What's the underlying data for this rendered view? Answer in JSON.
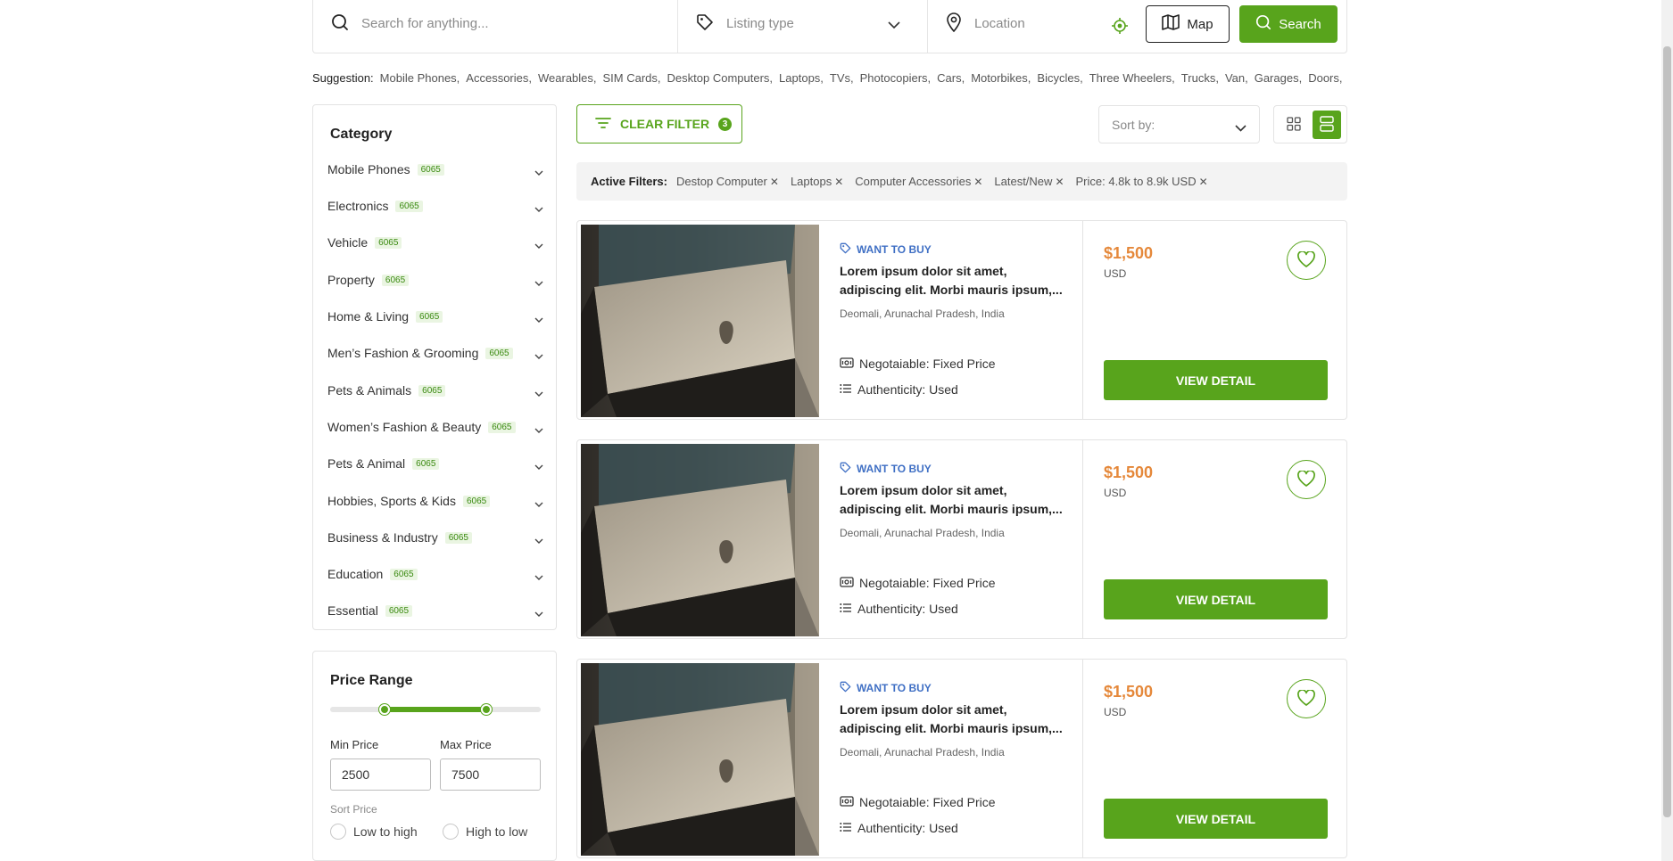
{
  "search": {
    "placeholder": "Search for anything...",
    "listing_type_placeholder": "Listing type",
    "location_placeholder": "Location",
    "map_label": "Map",
    "search_label": "Search"
  },
  "suggestions": {
    "label": "Suggestion:",
    "items": [
      "Mobile Phones,",
      "Accessories,",
      "Wearables,",
      "SIM Cards,",
      "Desktop Computers,",
      "Laptops,",
      "TVs,",
      "Photocopiers,",
      "Cars,",
      "Motorbikes,",
      "Bicycles,",
      "Three Wheelers,",
      "Trucks,",
      "Van,",
      "Garages,",
      "Doors,"
    ]
  },
  "sidebar": {
    "title": "Category",
    "categories": [
      {
        "name": "Mobile Phones",
        "count": "6065"
      },
      {
        "name": "Electronics",
        "count": "6065"
      },
      {
        "name": "Vehicle",
        "count": "6065"
      },
      {
        "name": "Property",
        "count": "6065"
      },
      {
        "name": "Home & Living",
        "count": "6065"
      },
      {
        "name": "Men’s Fashion & Grooming",
        "count": "6065"
      },
      {
        "name": "Pets & Animals",
        "count": "6065"
      },
      {
        "name": "Women’s Fashion & Beauty",
        "count": "6065"
      },
      {
        "name": "Pets & Animal",
        "count": "6065"
      },
      {
        "name": "Hobbies, Sports & Kids",
        "count": "6065"
      },
      {
        "name": "Business & Industry",
        "count": "6065"
      },
      {
        "name": "Education",
        "count": "6065"
      },
      {
        "name": "Essential",
        "count": "6065"
      }
    ]
  },
  "price_range": {
    "title": "Price Range",
    "slider_min_fraction": 0.26,
    "slider_max_fraction": 0.74,
    "min_label": "Min Price",
    "max_label": "Max Price",
    "min_value": "2500",
    "max_value": "7500",
    "sort_label": "Sort Price",
    "sort_options": [
      "Low to high",
      "High to low"
    ]
  },
  "toolbar": {
    "clear_filter_label": "CLEAR FILTER",
    "clear_filter_count": "3",
    "sort_placeholder": "Sort by:"
  },
  "active_filters": {
    "label": "Active Filters:",
    "items": [
      "Destop Computer",
      "Laptops",
      "Computer Accessories",
      "Latest/New",
      "Price: 4.8k to 8.9k USD"
    ],
    "remove_glyph": "✕"
  },
  "listings": [
    {
      "tag": "WANT TO BUY",
      "title": "Lorem ipsum dolor sit amet, adipiscing elit. Morbi mauris ipsum,...",
      "location": "Deomali, Arunachal Pradesh, India",
      "negotiable": "Negotaiable: Fixed Price",
      "authenticity": "Authenticity: Used",
      "price": "$1,500",
      "currency": "USD",
      "button": "VIEW DETAIL"
    },
    {
      "tag": "WANT TO BUY",
      "title": "Lorem ipsum dolor sit amet, adipiscing elit. Morbi mauris ipsum,...",
      "location": "Deomali, Arunachal Pradesh, India",
      "negotiable": "Negotaiable: Fixed Price",
      "authenticity": "Authenticity: Used",
      "price": "$1,500",
      "currency": "USD",
      "button": "VIEW DETAIL"
    },
    {
      "tag": "WANT TO BUY",
      "title": "Lorem ipsum dolor sit amet, adipiscing elit. Morbi mauris ipsum,...",
      "location": "Deomali, Arunachal Pradesh, India",
      "negotiable": "Negotaiable: Fixed Price",
      "authenticity": "Authenticity: Used",
      "price": "$1,500",
      "currency": "USD",
      "button": "VIEW DETAIL"
    }
  ],
  "colors": {
    "accent": "#58a41c",
    "price": "#e5883a",
    "tag": "#3f6fc4"
  },
  "icons": {
    "search": "search-icon",
    "listing_type": "tag-icon",
    "location": "map-pin-icon",
    "gps": "crosshair-icon",
    "map": "map-icon",
    "filter": "filter-icon",
    "grid_view": "grid-icon",
    "list_view": "list-icon",
    "favorite": "heart-icon"
  }
}
